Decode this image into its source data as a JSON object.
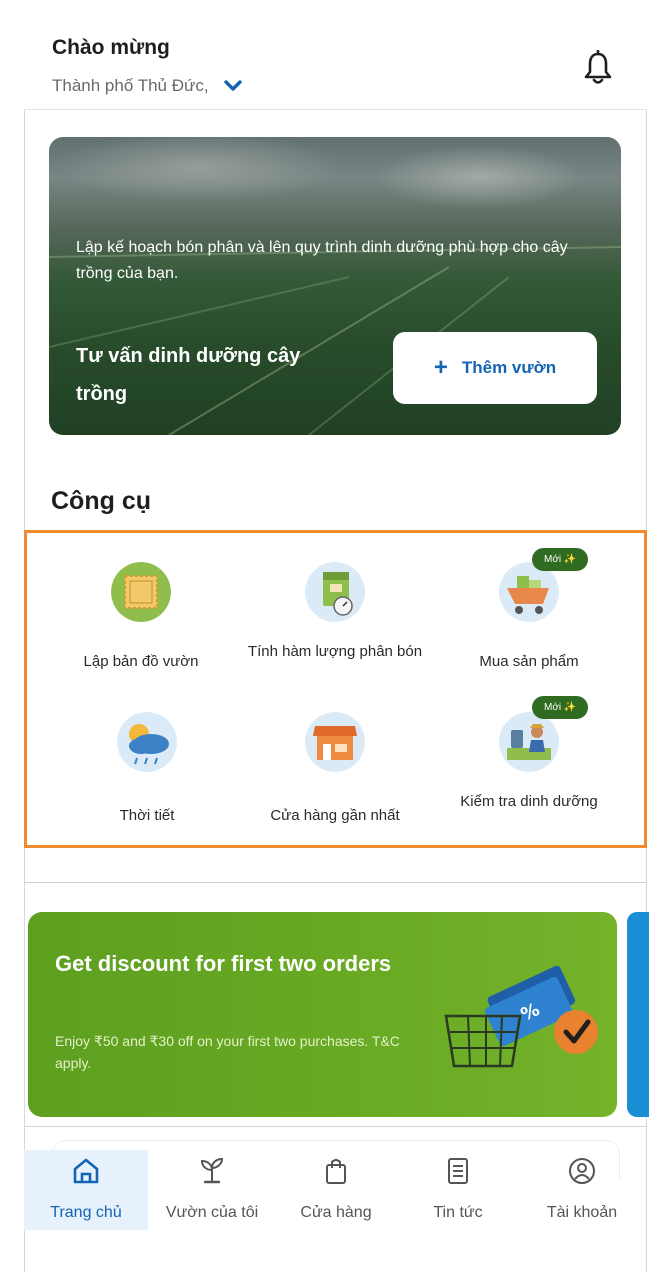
{
  "header": {
    "greeting": "Chào mừng",
    "location": "Thành phố Thủ Đức,",
    "icons": {
      "location_dropdown": "chevron-down-icon",
      "notification": "bell-icon"
    }
  },
  "banner": {
    "subtitle": "Lập kế hoạch bón phân và lên quy trình dinh dưỡng phù hợp cho cây trồng của bạn.",
    "title": "Tư vấn dinh dưỡng cây trồng",
    "button_label": "Thêm vườn",
    "button_icon": "plus-icon"
  },
  "tools": {
    "title": "Công cụ",
    "items": [
      {
        "label": "Lập bản đồ vườn",
        "icon": "garden-map-icon"
      },
      {
        "label": "Tính hàm lượng phân bón",
        "icon": "fertilizer-calculator-icon"
      },
      {
        "label": "Mua sản phẩm",
        "icon": "shopping-cart-icon",
        "badge": "Mới ✨"
      },
      {
        "label": "Thời tiết",
        "icon": "weather-icon"
      },
      {
        "label": "Cửa hàng gần nhất",
        "icon": "store-icon"
      },
      {
        "label": "Kiểm tra dinh dưỡng",
        "icon": "nutrition-check-icon",
        "badge": "Mới ✨"
      }
    ]
  },
  "promo": {
    "title": "Get discount for first two orders",
    "description": "Enjoy ₹50 and ₹30 off on your first two purchases. T&C apply.",
    "image": "discount-basket-icon"
  },
  "nav": {
    "items": [
      {
        "label": "Trang chủ",
        "icon": "home-icon",
        "active": true
      },
      {
        "label": "Vườn của tôi",
        "icon": "plant-icon",
        "active": false
      },
      {
        "label": "Cửa hàng",
        "icon": "shopping-bag-icon",
        "active": false
      },
      {
        "label": "Tin tức",
        "icon": "news-icon",
        "active": false
      },
      {
        "label": "Tài khoản",
        "icon": "account-icon",
        "active": false
      }
    ]
  },
  "colors": {
    "accent_blue": "#1464b4",
    "highlight_border": "#f08a2e",
    "promo_green": "#6aab24",
    "badge_green": "#2f6c21"
  }
}
